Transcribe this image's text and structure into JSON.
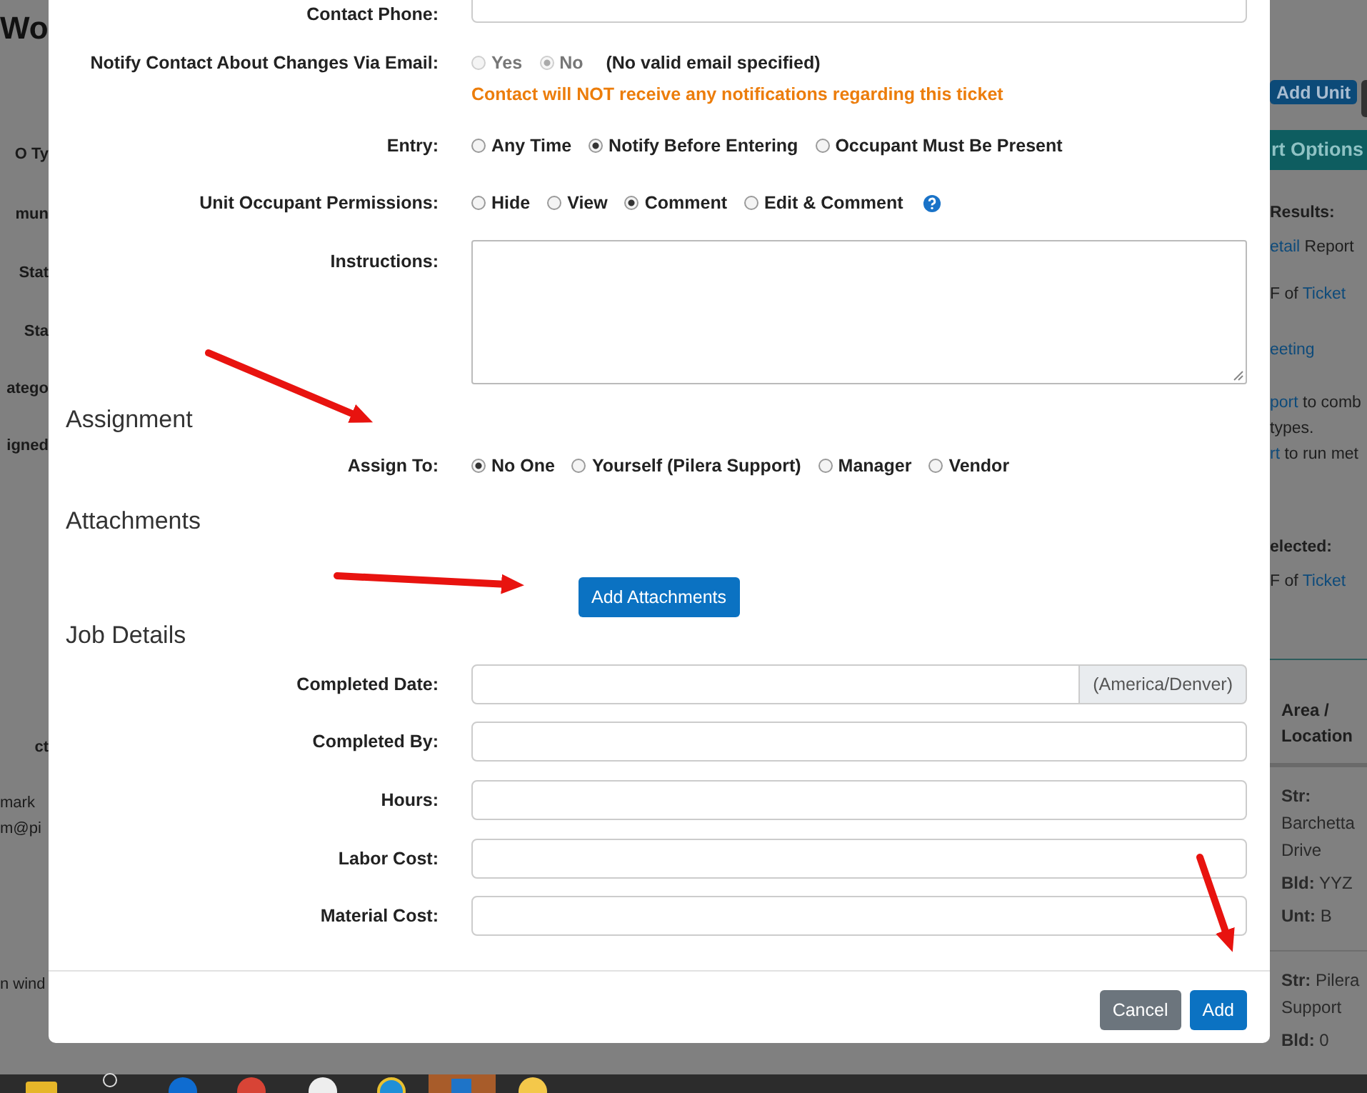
{
  "background_left": [
    {
      "text": "Wo",
      "kind": "title"
    },
    {
      "text": "O Ty",
      "kind": "label"
    },
    {
      "text": "mun",
      "kind": "label"
    },
    {
      "text": "Stat",
      "kind": "label"
    },
    {
      "text": "Sta",
      "kind": "label"
    },
    {
      "text": "atego",
      "kind": "label"
    },
    {
      "text": "igned",
      "kind": "label"
    },
    {
      "text": "ct",
      "kind": "header"
    },
    {
      "text": "mark",
      "kind": "text"
    },
    {
      "text": "m@pi",
      "kind": "text"
    },
    {
      "text": "n wind",
      "kind": "text"
    }
  ],
  "background_right": {
    "add_unit_button": "Add Unit",
    "options_header": "rt Options",
    "lines": [
      [
        {
          "text": "Results:",
          "kind": "bold"
        }
      ],
      [
        {
          "text": "etail",
          "kind": "link"
        },
        {
          "text": " Report",
          "kind": "plain"
        }
      ],
      [
        {
          "text": "F of ",
          "kind": "plain"
        },
        {
          "text": "Ticket",
          "kind": "link"
        }
      ],
      [
        {
          "text": "eeting",
          "kind": "link"
        }
      ],
      [
        {
          "text": "port",
          "kind": "link"
        },
        {
          "text": " to comb",
          "kind": "plain"
        }
      ],
      [
        {
          "text": "types.",
          "kind": "plain"
        }
      ],
      [
        {
          "text": "rt",
          "kind": "link"
        },
        {
          "text": " to run met",
          "kind": "plain"
        }
      ],
      [
        {
          "text": "elected:",
          "kind": "bold"
        }
      ],
      [
        {
          "text": "F of ",
          "kind": "plain"
        },
        {
          "text": "Ticket",
          "kind": "link"
        }
      ]
    ],
    "table_header": "Area / Location",
    "table_rows": [
      [
        {
          "label": "Str:",
          "value": "Barchetta Drive"
        },
        {
          "label": "Bld:",
          "value": "YYZ"
        },
        {
          "label": "Unt:",
          "value": "B"
        }
      ],
      [
        {
          "label": "Str:",
          "value": "Pilera Support"
        },
        {
          "label": "Bld:",
          "value": "0"
        }
      ]
    ]
  },
  "modal": {
    "contact_phone": {
      "label": "Contact Phone:"
    },
    "notify": {
      "label": "Notify Contact About Changes Via Email:",
      "options": [
        {
          "label": "Yes",
          "selected": false,
          "disabled": true
        },
        {
          "label": "No",
          "selected": true,
          "disabled": true
        }
      ],
      "note": "(No valid email specified)",
      "warning": "Contact will NOT receive any notifications regarding this ticket"
    },
    "entry": {
      "label": "Entry:",
      "options": [
        {
          "label": "Any Time",
          "selected": false,
          "disabled": false
        },
        {
          "label": "Notify Before Entering",
          "selected": true,
          "disabled": false
        },
        {
          "label": "Occupant Must Be Present",
          "selected": false,
          "disabled": false
        }
      ]
    },
    "permissions": {
      "label": "Unit Occupant Permissions:",
      "options": [
        {
          "label": "Hide",
          "selected": false,
          "disabled": false
        },
        {
          "label": "View",
          "selected": false,
          "disabled": false
        },
        {
          "label": "Comment",
          "selected": true,
          "disabled": false
        },
        {
          "label": "Edit & Comment",
          "selected": false,
          "disabled": false
        }
      ]
    },
    "instructions": {
      "label": "Instructions:"
    },
    "assignment_heading": "Assignment",
    "assign_to": {
      "label": "Assign To:",
      "options": [
        {
          "label": "No One",
          "selected": true,
          "disabled": false
        },
        {
          "label": "Yourself (Pilera Support)",
          "selected": false,
          "disabled": false
        },
        {
          "label": "Manager",
          "selected": false,
          "disabled": false
        },
        {
          "label": "Vendor",
          "selected": false,
          "disabled": false
        }
      ]
    },
    "attachments_heading": "Attachments",
    "add_attachments_button": "Add Attachments",
    "job_details_heading": "Job Details",
    "completed_date": {
      "label": "Completed Date:",
      "addon": "(America/Denver)"
    },
    "job_fields": [
      {
        "label": "Completed By:"
      },
      {
        "label": "Hours:"
      },
      {
        "label": "Labor Cost:"
      },
      {
        "label": "Material Cost:"
      }
    ],
    "buttons": [
      {
        "label": "Cancel",
        "kind": "secondary"
      },
      {
        "label": "Add",
        "kind": "primary"
      }
    ]
  }
}
